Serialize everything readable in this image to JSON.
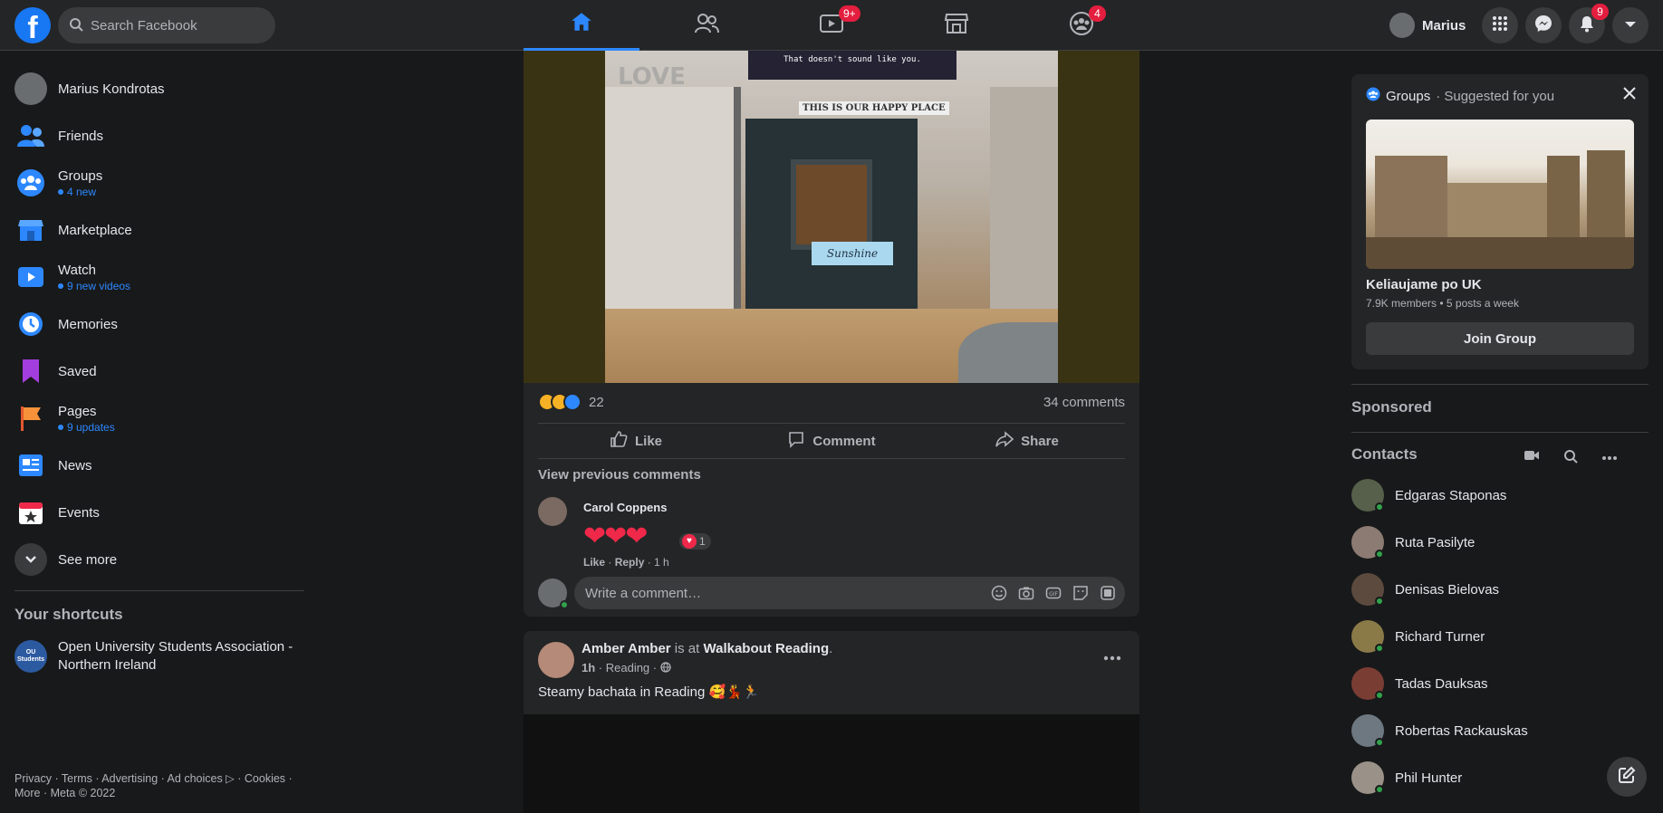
{
  "topbar": {
    "logo": "f",
    "search_placeholder": "Search Facebook",
    "nav": [
      {
        "name": "home",
        "icon": "home-icon",
        "active": true,
        "badge": ""
      },
      {
        "name": "friends",
        "icon": "friends-icon",
        "active": false,
        "badge": ""
      },
      {
        "name": "watch",
        "icon": "watch-icon",
        "active": false,
        "badge": "9+"
      },
      {
        "name": "marketplace",
        "icon": "marketplace-icon",
        "active": false,
        "badge": ""
      },
      {
        "name": "groups",
        "icon": "groups-icon",
        "active": false,
        "badge": "4"
      }
    ],
    "profile_name": "Marius",
    "notifications_badge": "9"
  },
  "leftnav": {
    "items": [
      {
        "label": "Marius Kondrotas",
        "sub": "",
        "icon": "profile-avatar"
      },
      {
        "label": "Friends",
        "sub": "",
        "icon": "friends-icon"
      },
      {
        "label": "Groups",
        "sub": "4 new",
        "icon": "groups-icon"
      },
      {
        "label": "Marketplace",
        "sub": "",
        "icon": "marketplace-icon"
      },
      {
        "label": "Watch",
        "sub": "9 new videos",
        "icon": "watch-icon"
      },
      {
        "label": "Memories",
        "sub": "",
        "icon": "memories-icon"
      },
      {
        "label": "Saved",
        "sub": "",
        "icon": "saved-icon"
      },
      {
        "label": "Pages",
        "sub": "9 updates",
        "icon": "pages-icon"
      },
      {
        "label": "News",
        "sub": "",
        "icon": "news-icon"
      },
      {
        "label": "Events",
        "sub": "",
        "icon": "events-icon"
      },
      {
        "label": "See more",
        "sub": "",
        "icon": "chevron-down-icon"
      }
    ],
    "shortcuts_title": "Your shortcuts",
    "shortcut": {
      "label": "Open University Students Association - Northern Ireland",
      "icon_text": "OU Students"
    },
    "footer_line1": "Privacy · Terms · Advertising · Ad choices ▷ · Cookies ·",
    "footer_line2": "More · Meta © 2022"
  },
  "post1": {
    "image_tv_text": "That doesn't sound like you.",
    "image_sign_text": "THIS IS OUR HAPPY PLACE",
    "image_board_text": "Sunshine",
    "image_love_text": "LOVE",
    "reaction_count": "22",
    "comments_count": "34 comments",
    "like_label": "Like",
    "comment_label": "Comment",
    "share_label": "Share",
    "view_previous": "View previous comments",
    "comment": {
      "author": "Carol Coppens",
      "hearts": "❤❤❤",
      "heart_reactions": "1",
      "like": "Like",
      "reply": "Reply",
      "time": "1 h"
    },
    "write_placeholder": "Write a comment…"
  },
  "post2": {
    "author": "Amber Amber",
    "is_at": " is at ",
    "place": "Walkabout Reading",
    "time": "1h",
    "location": "Reading",
    "text": "Steamy bachata in Reading 🥰💃🏃"
  },
  "right": {
    "suggest_header_bold": "Groups",
    "suggest_header_rest": " · Suggested for you",
    "group_name": "Keliaujame po UK",
    "group_meta": "7.9K members • 5 posts a week",
    "join_label": "Join Group",
    "sponsored": "Sponsored",
    "contacts_title": "Contacts",
    "contacts": [
      "Edgaras Staponas",
      "Ruta Pasilyte",
      "Denisas Bielovas",
      "Richard Turner",
      "Tadas Dauksas",
      "Robertas Rackauskas",
      "Phil Hunter"
    ]
  },
  "colors": {
    "accent": "#2d88ff",
    "badge": "#e41e3f",
    "online": "#31a24c",
    "bg": "#18191a",
    "card": "#242526"
  }
}
